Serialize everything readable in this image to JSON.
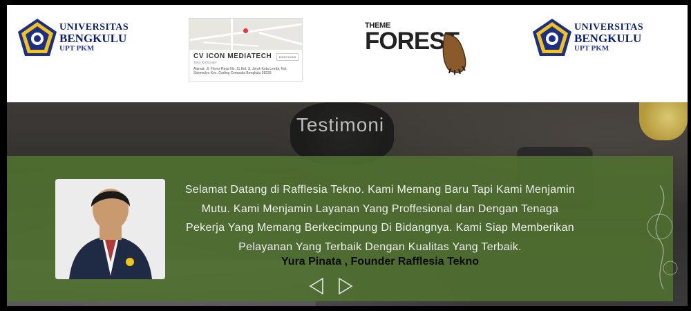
{
  "logos": {
    "unib_left": {
      "line1": "UNIVERSITAS",
      "line2": "BENGKULU",
      "line3": "UPT PKM",
      "seal_icon": "university-seal-icon"
    },
    "mapcard": {
      "title": "CV ICON MEDIATECH",
      "subtitle": "Toko Komputer",
      "address": "Alamat: Jl. Flores Raya No. 11 Kel. S. Jeruk Kota Lembt, Kel. Sidomulyo Kec. Gading Cempaka Bengkulu 38229",
      "directions": "DIRECTIONS",
      "pin_color": "#e53935"
    },
    "forest": {
      "small": "THEME",
      "big": "FOREST",
      "paw_icon": "bear-paw-icon"
    },
    "unib_right": {
      "line1": "UNIVERSITAS",
      "line2": "BENGKULU",
      "line3": "UPT PKM",
      "seal_icon": "university-seal-icon"
    }
  },
  "testimonial": {
    "section_title": "Testimoni",
    "quote_lines": [
      "Selamat Datang di Rafflesia Tekno. Kami Memang Baru Tapi Kami Menjamin",
      "Mutu. Kami Menjamin Layanan Yang Proffesional dan Dengan Tenaga",
      "Pekerja Yang Memang Berkecimpung Di Bidangnya. Kami Siap Memberikan",
      "Pelayanan Yang Terbaik Dengan Kualitas Yang Terbaik."
    ],
    "author": "Yura Pinata , Founder Rafflesia Tekno",
    "prev_icon": "chevron-left-icon",
    "next_icon": "chevron-right-icon",
    "panel_color": "#507030"
  }
}
